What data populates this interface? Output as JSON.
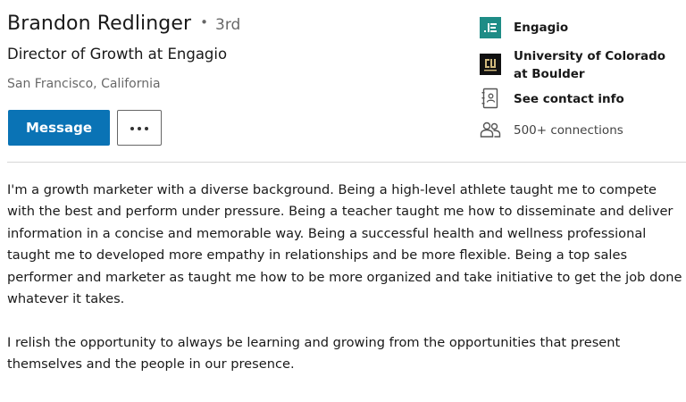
{
  "profile": {
    "name": "Brandon Redlinger",
    "bullet": "•",
    "degree": "3rd",
    "headline": "Director of Growth at Engagio",
    "location": "San Francisco, California"
  },
  "actions": {
    "message_label": "Message",
    "more_icon": "ellipsis-icon"
  },
  "sidebar": {
    "company": {
      "label": "Engagio",
      "icon": "engagio-logo",
      "color": "#1e8c86"
    },
    "school": {
      "label": "University of Colorado at Boulder",
      "icon": "cu-boulder-logo"
    },
    "contact": {
      "label": "See contact info",
      "icon": "contact-card-icon"
    },
    "connections": {
      "label": "500+ connections",
      "icon": "people-icon"
    }
  },
  "summary": {
    "paragraphs": [
      "I'm a growth marketer with a diverse background. Being a high-level athlete taught me to compete with the best and perform under pressure. Being a teacher taught me how to disseminate and deliver information in a concise and memorable way. Being a successful health and wellness professional taught me to developed more empathy in relationships and be more flexible. Being a top sales performer and marketer as taught me how to be more organized and take initiative to get the job done whatever it takes.",
      "I relish the opportunity to always be learning and growing from the opportunities that present themselves and the people in our presence."
    ]
  },
  "colors": {
    "primary_button": "#0a73b5",
    "engagio_teal": "#1e8c86"
  }
}
